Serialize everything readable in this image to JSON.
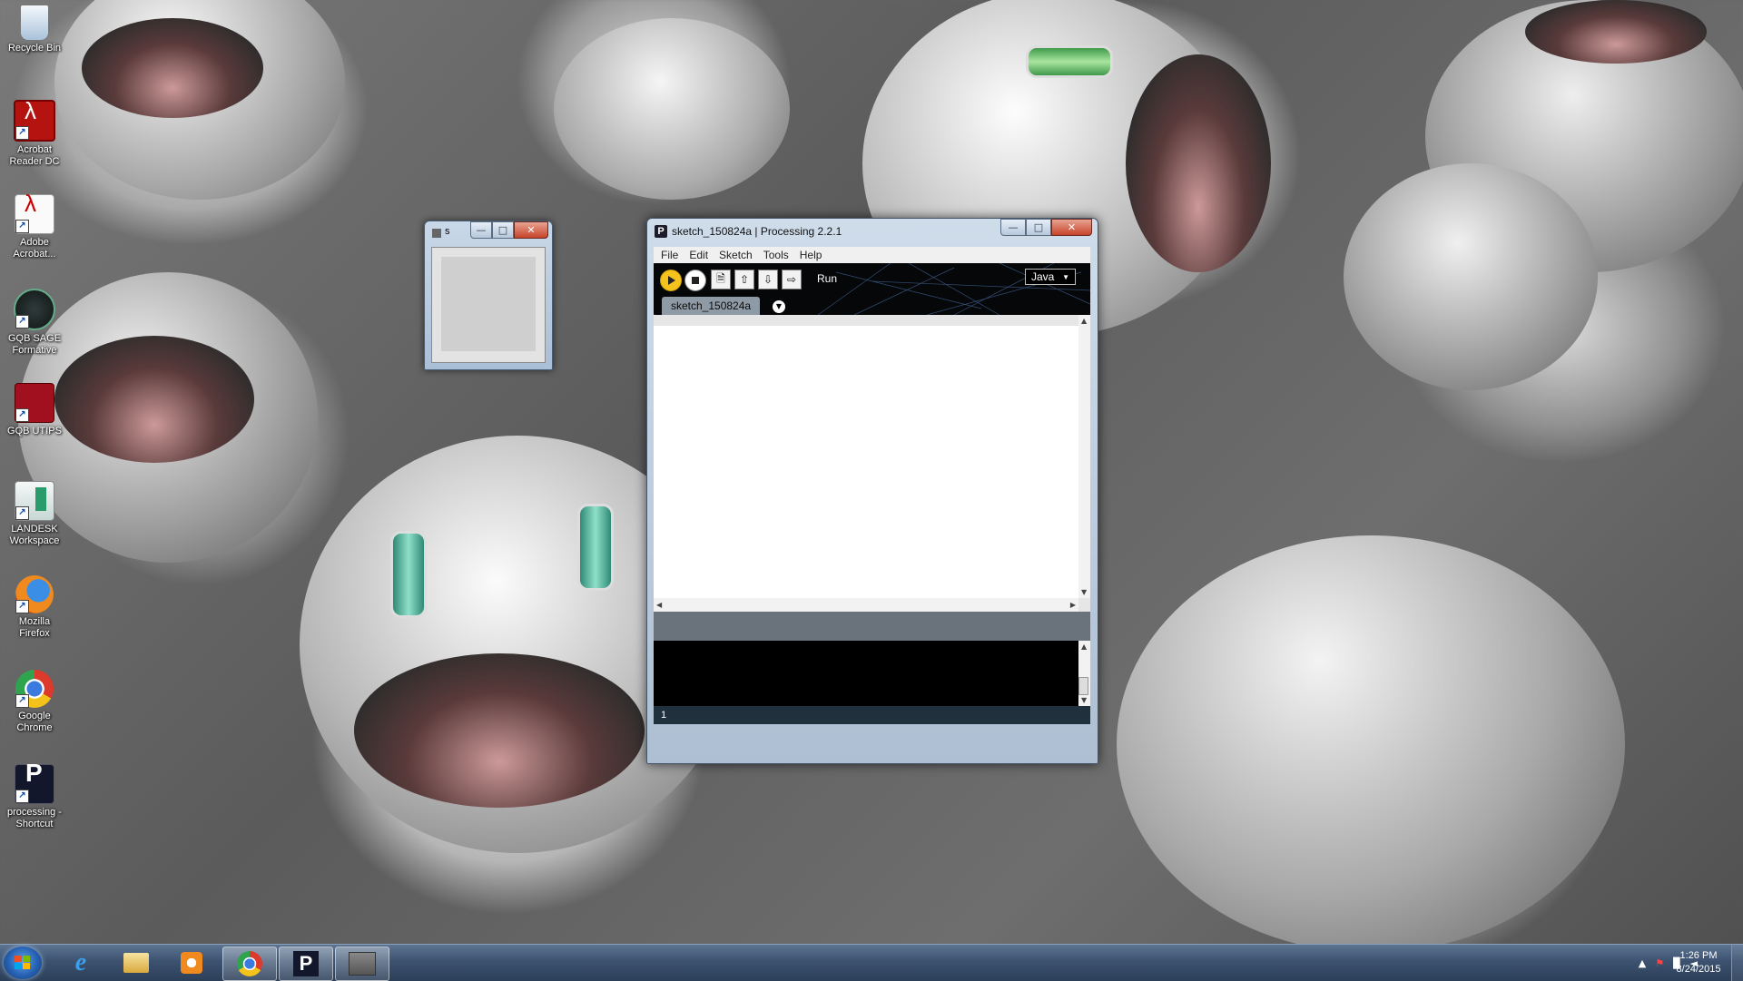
{
  "desktop": {
    "icons": [
      {
        "label": "Recycle Bin",
        "icon": "recycle-bin-icon"
      },
      {
        "label": "Acrobat Reader DC",
        "icon": "acrobat-reader-icon"
      },
      {
        "label": "Adobe Acrobat...",
        "icon": "adobe-acrobat-icon"
      },
      {
        "label": "GQB SAGE Formative",
        "icon": "gqb-sage-icon"
      },
      {
        "label": "GQB UTIPS",
        "icon": "gqb-utips-icon"
      },
      {
        "label": "LANDESK Workspace",
        "icon": "landesk-icon"
      },
      {
        "label": "Mozilla Firefox",
        "icon": "firefox-icon"
      },
      {
        "label": "Google Chrome",
        "icon": "chrome-icon"
      },
      {
        "label": "processing - Shortcut",
        "icon": "processing-icon"
      }
    ]
  },
  "small_window": {
    "title": "s"
  },
  "processing": {
    "title": "sketch_150824a | Processing 2.2.1",
    "menu": [
      "File",
      "Edit",
      "Sketch",
      "Tools",
      "Help"
    ],
    "toolbar": {
      "run_label": "Run",
      "mode": "Java",
      "buttons": [
        "run-icon",
        "stop-icon",
        "new-icon",
        "open-icon",
        "save-icon",
        "export-icon"
      ]
    },
    "tab": "sketch_150824a",
    "line_number": "1"
  },
  "taskbar": {
    "items": [
      "start",
      "internet-explorer-icon",
      "file-explorer-icon",
      "media-player-icon",
      "chrome-icon",
      "processing-icon",
      "java-window-icon"
    ],
    "clock_time": "1:26 PM",
    "clock_date": "8/24/2015"
  }
}
